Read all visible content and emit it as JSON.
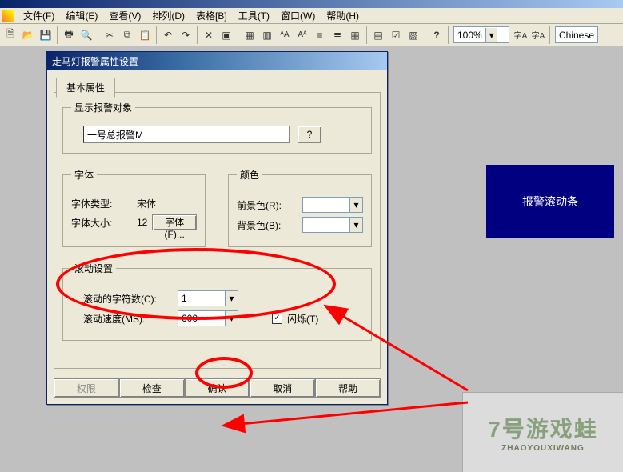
{
  "menubar": {
    "items": [
      "文件(F)",
      "编辑(E)",
      "查看(V)",
      "排列(D)",
      "表格[B]",
      "工具(T)",
      "窗口(W)",
      "帮助(H)"
    ]
  },
  "toolbar": {
    "zoom": "100%",
    "language": "Chinese"
  },
  "dialog": {
    "title": "走马灯报警属性设置",
    "tab": "基本属性",
    "alarm_group": {
      "legend": "显示报警对象",
      "value": "一号总报警M",
      "help": "?"
    },
    "font_group": {
      "legend": "字体",
      "type_label": "字体类型:",
      "type_value": "宋体",
      "size_label": "字体大小:",
      "size_value": "12",
      "font_btn": "字体(F)..."
    },
    "color_group": {
      "legend": "颜色",
      "fg_label": "前景色(R):",
      "bg_label": "背景色(B):",
      "fg_hex": "#ffffff",
      "bg_hex": "#000080"
    },
    "scroll_group": {
      "legend": "滚动设置",
      "chars_label": "滚动的字符数(C):",
      "chars_value": "1",
      "speed_label": "滚动速度(MS):",
      "speed_value": "600",
      "blink_checked": "✓",
      "blink_label": "闪烁(T)"
    },
    "buttons": {
      "perm": "权限",
      "check": "检查",
      "ok": "确认",
      "cancel": "取消",
      "help": "帮助"
    }
  },
  "preview": {
    "text": "报警滚动条"
  },
  "watermark": {
    "brand": "7号游戏蛙",
    "sub": "ZHAOYOUXIWANG"
  }
}
